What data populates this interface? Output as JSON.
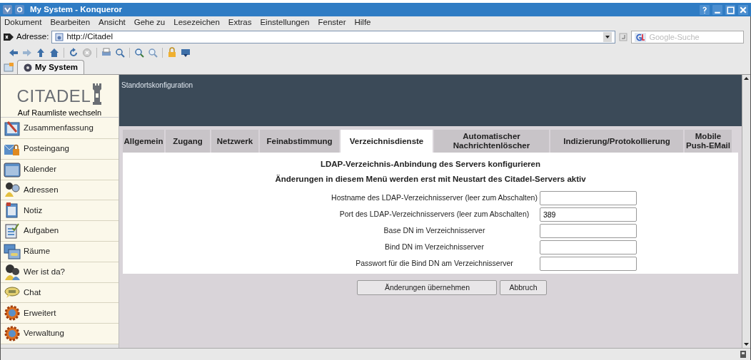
{
  "window": {
    "title": "My System - Konqueror"
  },
  "menu": [
    "Dokument",
    "Bearbeiten",
    "Ansicht",
    "Gehe zu",
    "Lesezeichen",
    "Extras",
    "Einstellungen",
    "Fenster",
    "Hilfe"
  ],
  "address": {
    "label": "Adresse:",
    "value": "http://Citadel"
  },
  "search": {
    "placeholder": "Google-Suche"
  },
  "browser_tabs": [
    {
      "label": "My System",
      "selected": true
    }
  ],
  "sidebar": {
    "logo": "CITADEL",
    "switch_link": "Auf Raumliste wechseln",
    "items": [
      {
        "label": "Zusammenfassung"
      },
      {
        "label": "Posteingang"
      },
      {
        "label": "Kalender"
      },
      {
        "label": "Adressen"
      },
      {
        "label": "Notiz"
      },
      {
        "label": "Aufgaben"
      },
      {
        "label": "Räume"
      },
      {
        "label": "Wer ist da?"
      },
      {
        "label": "Chat"
      },
      {
        "label": "Erweitert"
      },
      {
        "label": "Verwaltung"
      }
    ]
  },
  "page": {
    "header": "Standortskonfiguration",
    "tabs": [
      {
        "label": "Allgemein",
        "selected": false
      },
      {
        "label": "Zugang",
        "selected": false
      },
      {
        "label": "Netzwerk",
        "selected": false
      },
      {
        "label": "Feinabstimmung",
        "selected": false
      },
      {
        "label": "Verzeichnisdienste",
        "selected": true
      },
      {
        "label": "Automatischer Nachrichtenlöscher",
        "selected": false
      },
      {
        "label": "Indizierung/Protokollierung",
        "selected": false
      },
      {
        "label": "Mobile Push-EMail",
        "selected": false
      }
    ],
    "headings": [
      "LDAP-Verzeichnis-Anbindung des Servers konfigurieren",
      "Änderungen in diesem Menü werden erst mit Neustart des Citadel-Servers aktiv"
    ],
    "fields": [
      {
        "label": "Hostname des LDAP-Verzeichnisserver (leer zum Abschalten)"
      },
      {
        "label": "Port des LDAP-Verzeichnisservers (leer zum Abschalten)",
        "value": "389"
      },
      {
        "label": "Base DN im Verzeichnisserver"
      },
      {
        "label": "Bind DN im Verzeichnisserver"
      },
      {
        "label": "Passwort für die Bind DN am Verzeichnisserver"
      }
    ],
    "buttons": [
      "Änderungen übernehmen",
      "Abbruch"
    ]
  }
}
